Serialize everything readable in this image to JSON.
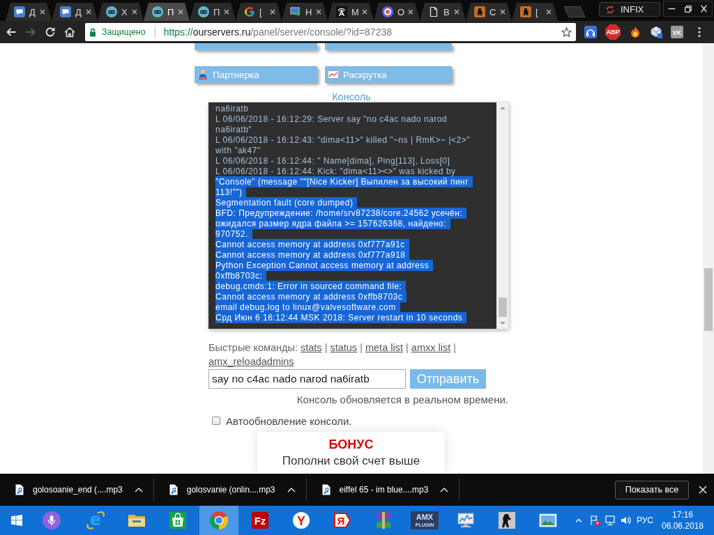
{
  "browser": {
    "tabs": [
      {
        "kind": "chat",
        "title": "Д",
        "selected": false
      },
      {
        "kind": "chat",
        "title": "Д",
        "selected": false
      },
      {
        "kind": "gamepad",
        "title": "Х",
        "selected": false
      },
      {
        "kind": "gamepad",
        "title": "П",
        "selected": true
      },
      {
        "kind": "gamepad",
        "title": "П",
        "selected": false
      },
      {
        "kind": "google",
        "title": "[",
        "selected": false
      },
      {
        "kind": "remote",
        "title": "Н",
        "selected": false
      },
      {
        "kind": "antenna",
        "title": "М",
        "selected": false
      },
      {
        "kind": "target",
        "title": "О",
        "selected": false
      },
      {
        "kind": "page",
        "title": "В",
        "selected": false
      },
      {
        "kind": "soldier",
        "title": "С",
        "selected": false
      },
      {
        "kind": "soldier",
        "title": "[",
        "selected": false
      }
    ],
    "profile": "INFIX",
    "nav": [
      {
        "kind": "back",
        "disabled": false
      },
      {
        "kind": "forward",
        "disabled": true
      },
      {
        "kind": "reload",
        "disabled": false
      },
      {
        "kind": "home",
        "disabled": false
      }
    ],
    "address": {
      "security": "Защищено",
      "url": [
        {
          "kind": "scheme",
          "text": "https://"
        },
        {
          "kind": "host",
          "text": "ourservers.ru"
        },
        {
          "kind": "path",
          "text": "/panel/server/console/?id=87238"
        }
      ],
      "bookmarked": false
    },
    "extensions": [
      {
        "kind": "headphones"
      },
      {
        "kind": "octagon",
        "label": "ABP"
      },
      {
        "kind": "flame"
      },
      {
        "kind": "cube"
      },
      {
        "kind": "tile",
        "label": "VK"
      }
    ]
  },
  "page": {
    "menu_buttons": [
      {
        "kind": "cut_off"
      },
      {
        "kind": "cut_off"
      },
      {
        "kind": "people",
        "label": "Партнерка"
      },
      {
        "kind": "chart",
        "label": "Раскрутка"
      }
    ],
    "console_title": "Консоль",
    "console": {
      "lines": [
        {
          "text": "na6iratb",
          "selected": false
        },
        {
          "text": "L 06/06/2018 - 16:12:29: Server say \"no c4ac nado narod",
          "selected": false
        },
        {
          "text": "na6iratb\"",
          "selected": false
        },
        {
          "text": "L 06/06/2018 - 16:12:43: \"dima<11>\" killed \"~ns | RmK>~ |<2>\"",
          "selected": false
        },
        {
          "text": "with \"ak47\"",
          "selected": false
        },
        {
          "text": "L 06/06/2018 - 16:12:44: \" Name[dima], Ping[113], Loss[0]",
          "selected": false
        },
        {
          "text": "L 06/06/2018 - 16:12:44: Kick: \"dima<11><>\" was kicked by",
          "selected": false
        },
        {
          "text": "\"Console\" (message \"\"[Nice Kicker] Выпилен за высокий пинг",
          "selected": true
        },
        {
          "text": "113!\"\")",
          "selected": true
        },
        {
          "text": "Segmentation fault (core dumped)",
          "selected": true
        },
        {
          "text": "BFD: Предупреждение: /home/srv87238/core.24562 усечён:",
          "selected": true
        },
        {
          "text": "ожидался размер ядра файла >= 157626368, найдено:",
          "selected": true
        },
        {
          "text": "970752.",
          "selected": true
        },
        {
          "text": "Cannot access memory at address 0xf777a91c",
          "selected": true
        },
        {
          "text": "Cannot access memory at address 0xf777a918",
          "selected": true
        },
        {
          "text": "Python Exception Cannot access memory at address",
          "selected": true
        },
        {
          "text": "0xffb8703c:",
          "selected": true
        },
        {
          "text": "debug.cmds:1: Error in sourced command file:",
          "selected": true
        },
        {
          "text": "Cannot access memory at address 0xffb8703c",
          "selected": true
        },
        {
          "text": "email debug.log to linux@valvesoftware.com",
          "selected": true
        },
        {
          "text": "Срд Июн 6 16:12:44 MSK 2018: Server restart in 10 seconds",
          "selected": true
        }
      ]
    },
    "quick_commands": {
      "label": "Быстрые команды:",
      "items": [
        {
          "kind": "link",
          "text": "stats"
        },
        {
          "kind": "separator",
          "text": "|"
        },
        {
          "kind": "link",
          "text": "status"
        },
        {
          "kind": "separator",
          "text": "|"
        },
        {
          "kind": "link",
          "text": "meta list"
        },
        {
          "kind": "separator",
          "text": "|"
        },
        {
          "kind": "link",
          "text": "amxx list"
        },
        {
          "kind": "separator",
          "text": "|"
        },
        {
          "kind": "link",
          "text": "amx_reloadadmins"
        }
      ]
    },
    "command_input": {
      "value": "say no c4ac nado narod na6iratb"
    },
    "send_button": "Отправить",
    "realtime_note": "Консоль обновляется в реальном времени.",
    "auto_update": {
      "label": "Автообновление консоли.",
      "checked": false
    },
    "bonus": {
      "title": "БОНУС",
      "text": "Пополни свой счет выше"
    }
  },
  "downloads": {
    "items": [
      {
        "name": "golosoanie_end (....mp3"
      },
      {
        "name": "golosvanie (onlin....mp3"
      },
      {
        "name": "eiffel 65 - im blue....mp3"
      }
    ],
    "show_all": "Показать все"
  },
  "taskbar": {
    "buttons": [
      {
        "kind": "windows",
        "selected": false
      },
      {
        "kind": "cortana",
        "selected": false
      },
      {
        "kind": "ie",
        "label": "e",
        "selected": false
      },
      {
        "kind": "explorer",
        "selected": false
      },
      {
        "kind": "store",
        "selected": false
      },
      {
        "kind": "chrome",
        "selected": true
      },
      {
        "kind": "filezilla",
        "label": "Fz",
        "selected": false
      },
      {
        "kind": "yandex_browser",
        "label": "Y",
        "selected": false
      },
      {
        "kind": "yandex",
        "label": "Я",
        "selected": false
      },
      {
        "kind": "winrar",
        "selected": false
      },
      {
        "kind": "amx",
        "label": "AMX",
        "sublabel": "PLUGIN",
        "selected": false
      },
      {
        "kind": "monitor",
        "selected": false
      },
      {
        "kind": "soldier",
        "selected": false
      },
      {
        "kind": "photos",
        "selected": false
      }
    ],
    "tray": {
      "language": "РУС",
      "time": "17:16",
      "date": "06.06.2018"
    }
  }
}
